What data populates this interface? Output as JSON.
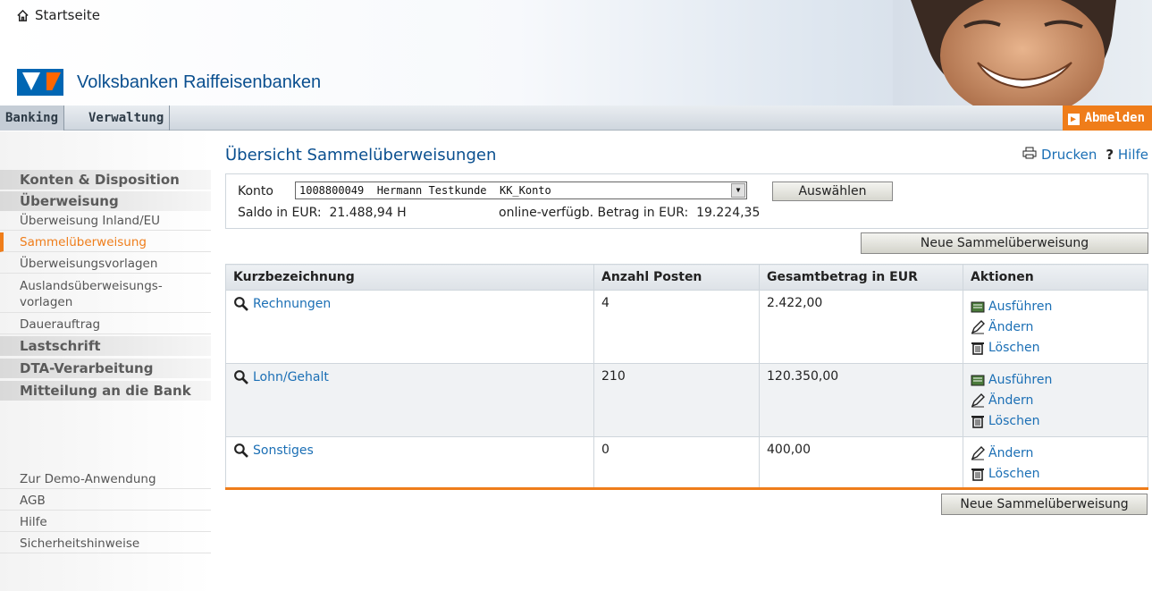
{
  "header": {
    "home_label": "Startseite",
    "brand_name": "Volksbanken Raiffeisenbanken"
  },
  "topnav": {
    "tabs": [
      {
        "label": "Banking",
        "active": true
      },
      {
        "label": "Verwaltung",
        "active": false
      }
    ],
    "logout_label": "Abmelden"
  },
  "sidebar": {
    "sections": [
      {
        "label": "Konten & Disposition"
      },
      {
        "label": "Überweisung"
      },
      {
        "label": "Überweisung Inland/EU"
      },
      {
        "label": "Sammelüberweisung",
        "active": true
      },
      {
        "label": "Überweisungsvorlagen"
      },
      {
        "label": "Auslandsüberweisungs-",
        "label2": "vorlagen"
      },
      {
        "label": "Dauerauftrag"
      },
      {
        "label": "Lastschrift"
      },
      {
        "label": "DTA-Verarbeitung"
      },
      {
        "label": "Mitteilung an die Bank"
      }
    ],
    "footer_links": [
      "Zur Demo-Anwendung",
      "AGB",
      "Hilfe",
      "Sicherheitshinweise"
    ]
  },
  "main": {
    "title": "Übersicht Sammelüberweisungen",
    "toolbar": {
      "print": "Drucken",
      "help": "Hilfe"
    },
    "konto": {
      "label": "Konto",
      "selected": "1008800049  Hermann Testkunde  KK_Konto",
      "select_button": "Auswählen",
      "saldo": "Saldo in EUR:  21.488,94 H",
      "verfuegbar": "online-verfügb. Betrag in EUR:  19.224,35"
    },
    "new_button": "Neue Sammelüberweisung",
    "table": {
      "headers": [
        "Kurzbezeichnung",
        "Anzahl Posten",
        "Gesamtbetrag in EUR",
        "Aktionen"
      ],
      "rows": [
        {
          "name": "Rechnungen",
          "count": "4",
          "total": "2.422,00",
          "actions": [
            "Ausführen",
            "Ändern",
            "Löschen"
          ]
        },
        {
          "name": "Lohn/Gehalt",
          "count": "210",
          "total": "120.350,00",
          "actions": [
            "Ausführen",
            "Ändern",
            "Löschen"
          ]
        },
        {
          "name": "Sonstiges",
          "count": "0",
          "total": "400,00",
          "actions": [
            "Ändern",
            "Löschen"
          ]
        }
      ]
    }
  },
  "colors": {
    "accent": "#ef7d1a",
    "link": "#1b6fb5",
    "brand_blue": "#0066b3"
  }
}
